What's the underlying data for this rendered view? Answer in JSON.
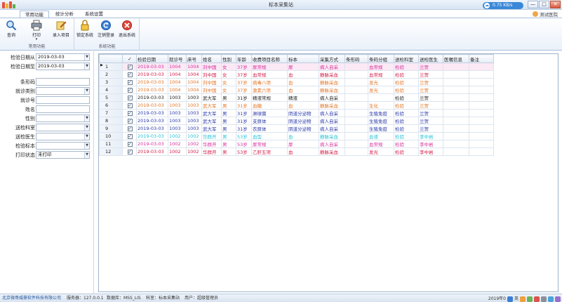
{
  "window": {
    "title": "标本采集站",
    "min_label": "—",
    "max_label": "□",
    "close_label": "✕",
    "network_speed": "0.75 KB/s"
  },
  "tabs": [
    {
      "label": "常用功能"
    },
    {
      "label": "统计分析"
    },
    {
      "label": "系统设置"
    }
  ],
  "user": {
    "name": "测试医院"
  },
  "ribbon": {
    "groups": [
      {
        "caption": "常用功能",
        "buttons": [
          {
            "label": "查询",
            "icon": "search-icon"
          },
          {
            "label": "打印",
            "icon": "printer-icon"
          },
          {
            "label": "录入项目",
            "icon": "entry-icon"
          }
        ]
      },
      {
        "caption": "系统功能",
        "buttons": [
          {
            "label": "锁定系统",
            "icon": "lock-icon"
          },
          {
            "label": "注销登录",
            "icon": "logout-icon"
          },
          {
            "label": "退出系统",
            "icon": "exit-icon"
          }
        ]
      }
    ]
  },
  "filters": {
    "date_from": {
      "label": "检验日期从",
      "value": "2019-03-03"
    },
    "date_to": {
      "label": "检验日期至",
      "value": "2019-03-03"
    },
    "barcode": {
      "label": "条形码",
      "value": ""
    },
    "visit_type": {
      "label": "就诊类别",
      "value": ""
    },
    "visit_no": {
      "label": "就诊号",
      "value": ""
    },
    "name": {
      "label": "姓名",
      "value": ""
    },
    "gender": {
      "label": "性别",
      "value": ""
    },
    "dept": {
      "label": "送检科室",
      "value": ""
    },
    "doctor": {
      "label": "送检医生",
      "value": ""
    },
    "specimen": {
      "label": "检验标本",
      "value": ""
    },
    "print_status": {
      "label": "打印状态",
      "value": "未打印"
    }
  },
  "grid": {
    "columns": [
      "",
      "✓",
      "检验日期",
      "就诊号",
      "床号",
      "姓名",
      "性别",
      "年龄",
      "收费项目名称",
      "标本",
      "采集方式",
      "条形码",
      "条码分组",
      "送检科室",
      "送检医生",
      "医嘱信息",
      "备注"
    ],
    "rows": [
      {
        "no": "1",
        "checked": "✓",
        "color": "#d6319c",
        "cells": [
          "2019-03-03",
          "1004",
          "1004",
          "刘中国",
          "女",
          "37岁",
          "尿常规",
          "尿",
          "病人自采",
          "",
          "血常规",
          "检验",
          "兰贺",
          "",
          ""
        ]
      },
      {
        "no": "2",
        "checked": "✓",
        "color": "#d4204a",
        "cells": [
          "2019-03-03",
          "1004",
          "1004",
          "刘中国",
          "女",
          "37岁",
          "血常规",
          "血",
          "静脉采血",
          "",
          "血常规",
          "检验",
          "兰贺",
          "",
          ""
        ]
      },
      {
        "no": "3",
        "checked": "✓",
        "color": "#e2772a",
        "cells": [
          "2019-03-03",
          "1004",
          "1004",
          "刘中国",
          "女",
          "37岁",
          "病毒八项",
          "血",
          "静脉采血",
          "",
          "发光",
          "检验",
          "兰贺",
          "",
          ""
        ]
      },
      {
        "no": "4",
        "checked": "✓",
        "color": "#e2772a",
        "cells": [
          "2019-03-03",
          "1004",
          "1004",
          "刘中国",
          "女",
          "37岁",
          "激素六项",
          "血",
          "静脉采血",
          "",
          "发光",
          "检验",
          "兰贺",
          "",
          ""
        ]
      },
      {
        "no": "5",
        "checked": "✓",
        "color": "#222222",
        "cells": [
          "2019-03-03",
          "1003",
          "1003",
          "武大军",
          "男",
          "31岁",
          "精液常规",
          "精液",
          "病人自采",
          "",
          "",
          "检验",
          "兰贺",
          "",
          ""
        ]
      },
      {
        "no": "6",
        "checked": "✓",
        "color": "#e2772a",
        "cells": [
          "2019-03-03",
          "1003",
          "1003",
          "武大军",
          "男",
          "31岁",
          "血糖",
          "血",
          "静脉采血",
          "",
          "生化",
          "检验",
          "兰贺",
          "",
          ""
        ]
      },
      {
        "no": "7",
        "checked": "✓",
        "color": "#2a3aa8",
        "cells": [
          "2019-03-03",
          "1003",
          "1003",
          "武大军",
          "男",
          "31岁",
          "淋球菌",
          "阴道分泌物",
          "病人自采",
          "",
          "生殖免疫",
          "检验",
          "兰贺",
          "",
          ""
        ]
      },
      {
        "no": "8",
        "checked": "✓",
        "color": "#2a3aa8",
        "cells": [
          "2019-03-03",
          "1003",
          "1003",
          "武大军",
          "男",
          "31岁",
          "支原体",
          "阴道分泌物",
          "病人自采",
          "",
          "生殖免疫",
          "检验",
          "兰贺",
          "",
          ""
        ]
      },
      {
        "no": "9",
        "checked": "✓",
        "color": "#2a3aa8",
        "cells": [
          "2019-03-03",
          "1003",
          "1003",
          "武大军",
          "男",
          "31岁",
          "衣原体",
          "阴道分泌物",
          "病人自采",
          "",
          "生殖免疫",
          "检验",
          "兰贺",
          "",
          ""
        ]
      },
      {
        "no": "10",
        "checked": "✓",
        "color": "#27c3d6",
        "cells": [
          "2019-03-03",
          "1002",
          "1002",
          "华群开",
          "男",
          "53岁",
          "血型",
          "血",
          "静脉采血",
          "",
          "血液",
          "检验",
          "李中岩",
          "",
          ""
        ]
      },
      {
        "no": "11",
        "checked": "✓",
        "color": "#d6319c",
        "cells": [
          "2019-03-03",
          "1002",
          "1002",
          "华群开",
          "男",
          "53岁",
          "尿常规",
          "尿",
          "病人自采",
          "",
          "血常规",
          "检验",
          "李中岩",
          "",
          ""
        ]
      },
      {
        "no": "12",
        "checked": "✓",
        "color": "#d4204a",
        "cells": [
          "2019-03-03",
          "1002",
          "1002",
          "华群开",
          "男",
          "53岁",
          "乙肝五项",
          "血",
          "静脉采血",
          "",
          "发光",
          "检验",
          "李中岩",
          "",
          ""
        ]
      }
    ]
  },
  "statusbar": {
    "company": "北京微哥威豪软件科技有限公司",
    "server": "服务器：127.0.0.1",
    "database": "数据库：MSS_LIS",
    "department": "科室：标本采集站",
    "user": "用户：超级管理员",
    "date": "2019年0",
    "ime": "英"
  },
  "colors": {
    "accent": "#3a88d8",
    "ribbon_border": "#a8bedb",
    "selected_row": "#fbe9f5"
  }
}
